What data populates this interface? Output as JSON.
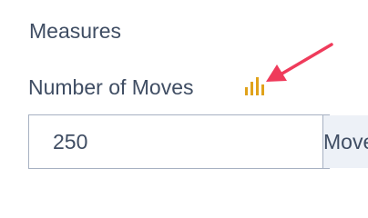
{
  "section": {
    "title": "Measures"
  },
  "field": {
    "label": "Number of Moves",
    "icon": "bar-chart-icon",
    "icon_color": "#e0a21a",
    "value": "250",
    "unit": "Moves"
  },
  "annotation": {
    "icon": "arrow-icon",
    "color": "#ef3b5b"
  }
}
